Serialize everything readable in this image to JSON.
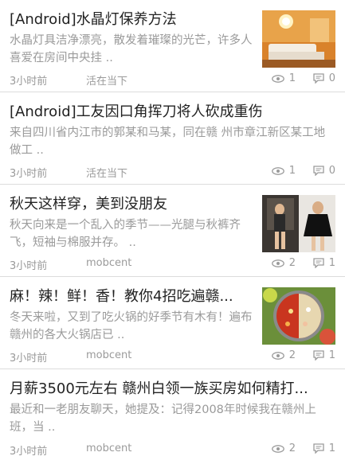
{
  "articles": [
    {
      "title": "[Android]水晶灯保养方法",
      "summary": "水晶灯具洁净漂亮，散发着璀璨的光芒，许多人喜爱在房间中央挂 ..",
      "time": "3小时前",
      "author": "活在当下",
      "views": "1",
      "comments": "0",
      "has_thumb": true
    },
    {
      "title": "[Android]工友因口角挥刀将人砍成重伤",
      "summary": "来自四川省内江市的郭某和马某，同在赣 州市章江新区某工地做工 ..",
      "time": "3小时前",
      "author": "活在当下",
      "views": "1",
      "comments": "0",
      "has_thumb": false
    },
    {
      "title": "秋天这样穿，美到没朋友",
      "summary": "秋天向来是一个乱入的季节——光腿与秋裤齐飞，短袖与棉服并存。 ..",
      "time": "3小时前",
      "author": "mobcent",
      "views": "2",
      "comments": "1",
      "has_thumb": true
    },
    {
      "title": "麻！辣！鲜！香！教你4招吃遍赣...",
      "summary": "冬天来啦，又到了吃火锅的好季节有木有！遍布赣州的各大火锅店已 ..",
      "time": "3小时前",
      "author": "mobcent",
      "views": "2",
      "comments": "1",
      "has_thumb": true
    },
    {
      "title": "月薪3500元左右 赣州白领一族买房如何精打...",
      "summary": " 最近和一老朋友聊天，她提及：记得2008年时候我在赣州上班，当 ..",
      "time": "3小时前",
      "author": "mobcent",
      "views": "2",
      "comments": "1",
      "has_thumb": false
    }
  ],
  "icons": {
    "views": "eye-icon",
    "comments": "comment-icon"
  },
  "colors": {
    "meta_text": "#9a9a9a",
    "title_text": "#222222",
    "divider": "#dcdcdc"
  }
}
